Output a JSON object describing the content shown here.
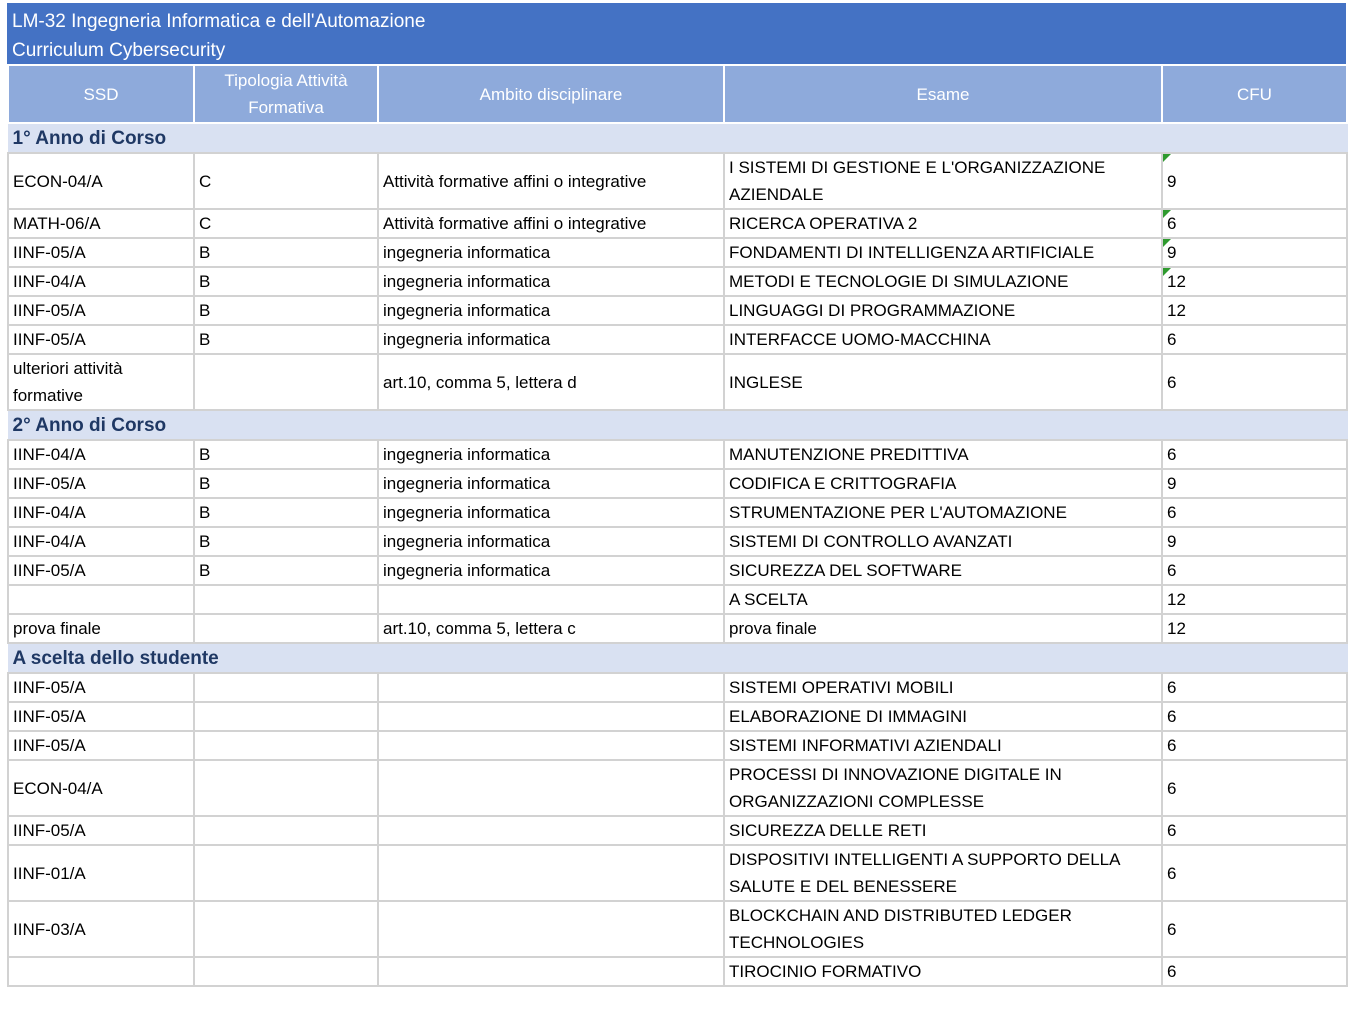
{
  "title": {
    "line1": "LM-32 Ingegneria Informatica e dell'Automazione",
    "line2": "Curriculum Cybersecurity"
  },
  "columns": [
    "SSD",
    "Tipologia Attività Formativa",
    "Ambito disciplinare",
    "Esame",
    "CFU"
  ],
  "colors": {
    "title_band": "#4472c4",
    "header": "#8eaadb",
    "section": "#d9e1f2",
    "flag": "#2e9a2e"
  },
  "sections": [
    {
      "label": "1° Anno di Corso",
      "rows": [
        {
          "ssd": "ECON-04/A",
          "tipologia": "C",
          "ambito": "Attività formative affini o integrative",
          "esame": "I SISTEMI DI GESTIONE E L'ORGANIZZAZIONE AZIENDALE",
          "cfu": "9",
          "flag": true
        },
        {
          "ssd": "MATH-06/A",
          "tipologia": "C",
          "ambito": "Attività formative affini o integrative",
          "esame": "RICERCA OPERATIVA 2",
          "cfu": "6",
          "flag": true
        },
        {
          "ssd": "IINF-05/A",
          "tipologia": "B",
          "ambito": "ingegneria informatica",
          "esame": "FONDAMENTI DI INTELLIGENZA ARTIFICIALE",
          "cfu": "9",
          "flag": true
        },
        {
          "ssd": "IINF-04/A",
          "tipologia": "B",
          "ambito": "ingegneria informatica",
          "esame": "METODI E TECNOLOGIE DI SIMULAZIONE",
          "cfu": "12",
          "flag": true
        },
        {
          "ssd": "IINF-05/A",
          "tipologia": "B",
          "ambito": "ingegneria informatica",
          "esame": "LINGUAGGI DI PROGRAMMAZIONE",
          "cfu": "12",
          "flag": false
        },
        {
          "ssd": "IINF-05/A",
          "tipologia": "B",
          "ambito": "ingegneria informatica",
          "esame": "INTERFACCE UOMO-MACCHINA",
          "cfu": "6",
          "flag": false
        },
        {
          "ssd": "ulteriori attività formative",
          "tipologia": "",
          "ambito": "art.10, comma 5, lettera d",
          "esame": "INGLESE",
          "cfu": "6",
          "flag": false
        }
      ]
    },
    {
      "label": "2° Anno di Corso",
      "rows": [
        {
          "ssd": "IINF-04/A",
          "tipologia": "B",
          "ambito": "ingegneria informatica",
          "esame": "MANUTENZIONE PREDITTIVA",
          "cfu": "6",
          "flag": false
        },
        {
          "ssd": "IINF-05/A",
          "tipologia": "B",
          "ambito": "ingegneria informatica",
          "esame": "CODIFICA E CRITTOGRAFIA",
          "cfu": "9",
          "flag": false
        },
        {
          "ssd": "IINF-04/A",
          "tipologia": "B",
          "ambito": "ingegneria informatica",
          "esame": "STRUMENTAZIONE PER L'AUTOMAZIONE",
          "cfu": "6",
          "flag": false
        },
        {
          "ssd": "IINF-04/A",
          "tipologia": "B",
          "ambito": "ingegneria informatica",
          "esame": "SISTEMI DI CONTROLLO AVANZATI",
          "cfu": "9",
          "flag": false
        },
        {
          "ssd": "IINF-05/A",
          "tipologia": "B",
          "ambito": "ingegneria informatica",
          "esame": "SICUREZZA DEL SOFTWARE",
          "cfu": "6",
          "flag": false
        },
        {
          "ssd": "",
          "tipologia": "",
          "ambito": "",
          "esame": "A SCELTA",
          "cfu": "12",
          "flag": false
        },
        {
          "ssd": "prova finale",
          "tipologia": "",
          "ambito": "art.10, comma 5, lettera c",
          "esame": "prova finale",
          "cfu": "12",
          "flag": false
        }
      ]
    },
    {
      "label": "A scelta dello studente",
      "rows": [
        {
          "ssd": "IINF-05/A",
          "tipologia": "",
          "ambito": "",
          "esame": "SISTEMI OPERATIVI MOBILI",
          "cfu": "6",
          "flag": false
        },
        {
          "ssd": "IINF-05/A",
          "tipologia": "",
          "ambito": "",
          "esame": "ELABORAZIONE DI IMMAGINI",
          "cfu": "6",
          "flag": false
        },
        {
          "ssd": "IINF-05/A",
          "tipologia": "",
          "ambito": "",
          "esame": "SISTEMI INFORMATIVI AZIENDALI",
          "cfu": "6",
          "flag": false
        },
        {
          "ssd": "ECON-04/A",
          "tipologia": "",
          "ambito": "",
          "esame": "PROCESSI DI INNOVAZIONE DIGITALE IN ORGANIZZAZIONI COMPLESSE",
          "cfu": "6",
          "flag": false
        },
        {
          "ssd": "IINF-05/A",
          "tipologia": "",
          "ambito": "",
          "esame": "SICUREZZA DELLE RETI",
          "cfu": "6",
          "flag": false
        },
        {
          "ssd": "IINF-01/A",
          "tipologia": "",
          "ambito": "",
          "esame": "DISPOSITIVI INTELLIGENTI A SUPPORTO DELLA SALUTE E DEL BENESSERE",
          "cfu": "6",
          "flag": false
        },
        {
          "ssd": "IINF-03/A",
          "tipologia": "",
          "ambito": "",
          "esame": "BLOCKCHAIN AND DISTRIBUTED LEDGER TECHNOLOGIES",
          "cfu": "6",
          "flag": false
        },
        {
          "ssd": "",
          "tipologia": "",
          "ambito": "",
          "esame": "TIROCINIO FORMATIVO",
          "cfu": "6",
          "flag": false
        }
      ]
    }
  ]
}
